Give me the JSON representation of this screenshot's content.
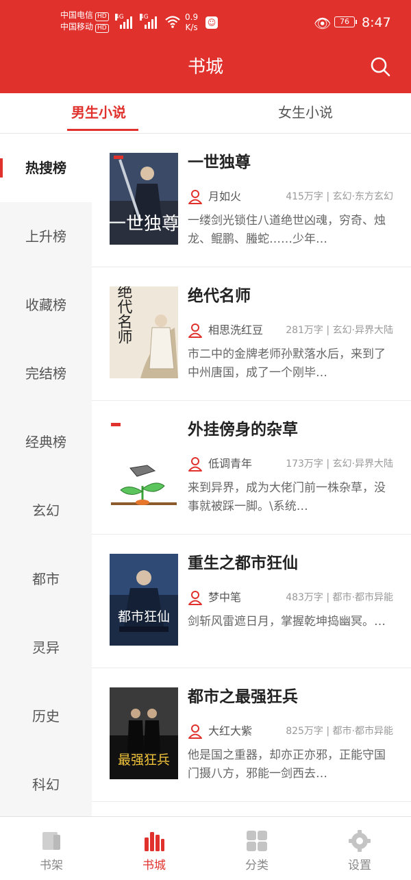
{
  "status_bar": {
    "carrier1": "中国电信",
    "carrier2": "中国移动",
    "hd": "HD",
    "net1": "4G",
    "net2": "4G",
    "speed_value": "0.9",
    "speed_unit": "K/s",
    "battery": "76",
    "time": "8:47"
  },
  "header": {
    "title": "书城"
  },
  "tabs": {
    "male": "男生小说",
    "female": "女生小说",
    "active": "male"
  },
  "sidebar": {
    "items": [
      {
        "label": "热搜榜",
        "active": true
      },
      {
        "label": "上升榜"
      },
      {
        "label": "收藏榜"
      },
      {
        "label": "完结榜"
      },
      {
        "label": "经典榜"
      },
      {
        "label": "玄幻"
      },
      {
        "label": "都市"
      },
      {
        "label": "灵异"
      },
      {
        "label": "历史"
      },
      {
        "label": "科幻"
      }
    ]
  },
  "books": [
    {
      "title": "一世独尊",
      "author": "月如火",
      "tags": "415万字 | 玄幻·东方玄幻",
      "desc": "一缕剑光锁住八道绝世凶魂，穷奇、烛龙、鲲鹏、螣蛇……少年…",
      "cover_title": "一世独尊"
    },
    {
      "title": "绝代名师",
      "author": "相思洗红豆",
      "tags": "281万字 | 玄幻·异界大陆",
      "desc": "市二中的金牌老师孙默落水后，来到了中州唐国，成了一个刚毕…",
      "cover_title": "绝代名师"
    },
    {
      "title": "外挂傍身的杂草",
      "author": "低调青年",
      "tags": "173万字 | 玄幻·异界大陆",
      "desc": "来到异界，成为大佬门前一株杂草，没事就被踩一脚。\\系统…",
      "cover_title": ""
    },
    {
      "title": "重生之都市狂仙",
      "author": "梦中笔",
      "tags": "483万字 | 都市·都市异能",
      "desc": "剑斩风雷遮日月，掌握乾坤捣幽冥。…",
      "cover_title": "都市狂仙"
    },
    {
      "title": "都市之最强狂兵",
      "author": "大红大紫",
      "tags": "825万字 | 都市·都市异能",
      "desc": "他是国之重器，却亦正亦邪，正能守国门摄八方，邪能一剑西去…",
      "cover_title": "最强狂兵"
    }
  ],
  "bottom_nav": [
    {
      "label": "书架",
      "icon": "bookshelf-icon"
    },
    {
      "label": "书城",
      "icon": "bookstore-icon",
      "active": true
    },
    {
      "label": "分类",
      "icon": "category-icon"
    },
    {
      "label": "设置",
      "icon": "settings-icon"
    }
  ],
  "colors": {
    "accent": "#e0312d",
    "sidebar_bg": "#f6f6f6",
    "muted": "#999999"
  }
}
